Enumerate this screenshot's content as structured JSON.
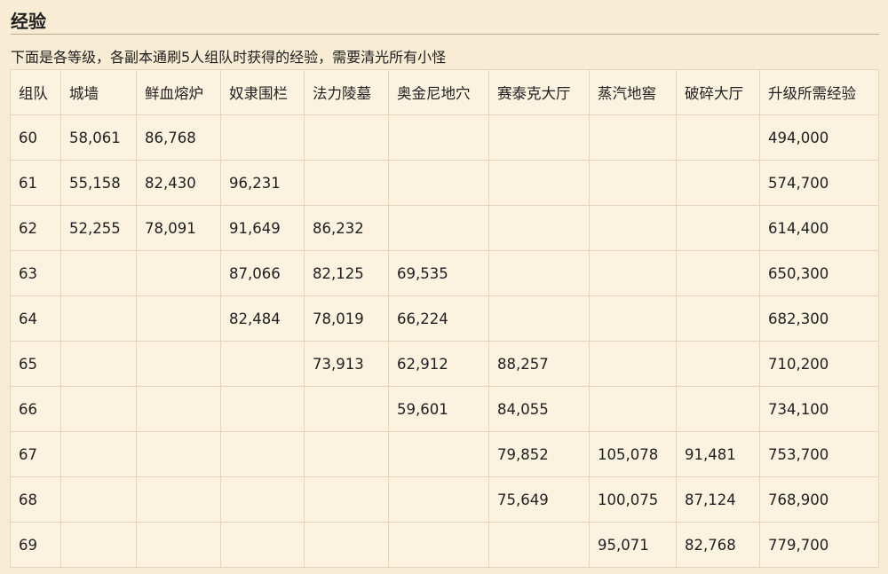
{
  "section": {
    "title": "经验",
    "description": "下面是各等级，各副本通刷5人组队时获得的经验，需要清光所有小怪"
  },
  "table": {
    "headers": [
      "组队",
      "城墙",
      "鲜血熔炉",
      "奴隶围栏",
      "法力陵墓",
      "奥金尼地穴",
      "赛泰克大厅",
      "蒸汽地窖",
      "破碎大厅",
      "升级所需经验"
    ],
    "rows": [
      [
        "60",
        "58,061",
        "86,768",
        "",
        "",
        "",
        "",
        "",
        "",
        "494,000"
      ],
      [
        "61",
        "55,158",
        "82,430",
        "96,231",
        "",
        "",
        "",
        "",
        "",
        "574,700"
      ],
      [
        "62",
        "52,255",
        "78,091",
        "91,649",
        "86,232",
        "",
        "",
        "",
        "",
        "614,400"
      ],
      [
        "63",
        "",
        "",
        "87,066",
        "82,125",
        "69,535",
        "",
        "",
        "",
        "650,300"
      ],
      [
        "64",
        "",
        "",
        "82,484",
        "78,019",
        "66,224",
        "",
        "",
        "",
        "682,300"
      ],
      [
        "65",
        "",
        "",
        "",
        "73,913",
        "62,912",
        "88,257",
        "",
        "",
        "710,200"
      ],
      [
        "66",
        "",
        "",
        "",
        "",
        "59,601",
        "84,055",
        "",
        "",
        "734,100"
      ],
      [
        "67",
        "",
        "",
        "",
        "",
        "",
        "79,852",
        "105,078",
        "91,481",
        "753,700"
      ],
      [
        "68",
        "",
        "",
        "",
        "",
        "",
        "75,649",
        "100,075",
        "87,124",
        "768,900"
      ],
      [
        "69",
        "",
        "",
        "",
        "",
        "",
        "",
        "95,071",
        "82,768",
        "779,700"
      ]
    ]
  }
}
